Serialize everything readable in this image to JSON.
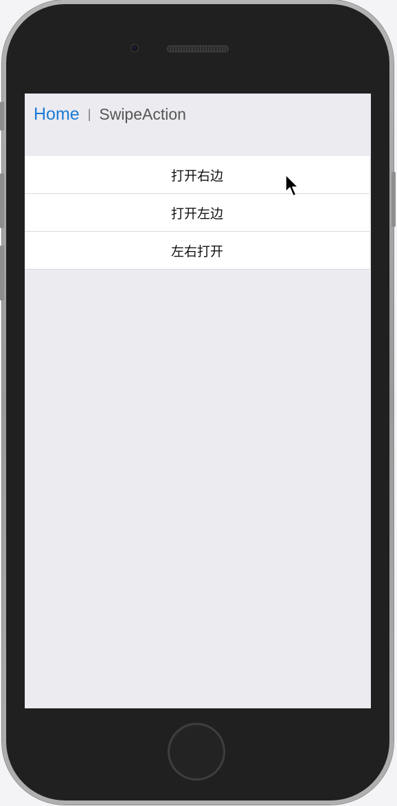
{
  "nav": {
    "home_label": "Home",
    "separator": "|",
    "title": "SwipeAction"
  },
  "list": {
    "items": [
      {
        "label": "打开右边"
      },
      {
        "label": "打开左边"
      },
      {
        "label": "左右打开"
      }
    ]
  },
  "colors": {
    "link": "#1a7bd6",
    "screen_bg": "#ebebf0",
    "item_bg": "#ffffff",
    "phone_body": "#202020"
  },
  "icons": {
    "cursor": "mouse-pointer-icon",
    "camera": "front-camera-icon",
    "speaker": "earpiece-speaker-icon",
    "home": "home-button-icon"
  }
}
